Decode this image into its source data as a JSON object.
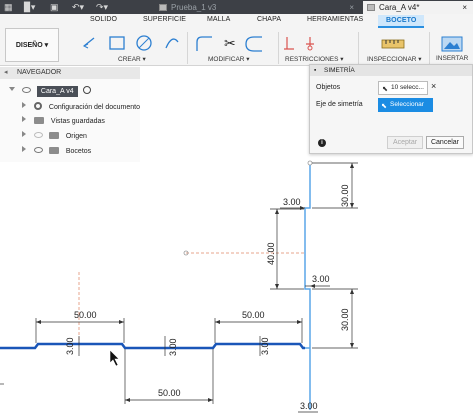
{
  "titlebar": {
    "tab1": "Prueba_1 v3",
    "tab2": "Cara_A v4*",
    "close": "×"
  },
  "ribbon": {
    "tabs": [
      "SOLIDO",
      "SUPERFICIE",
      "MALLA",
      "CHAPA",
      "HERRAMIENTAS",
      "BOCETO"
    ],
    "design_label": "DISEÑO ▾",
    "groups": [
      "CREAR ▾",
      "MODIFICAR ▾",
      "RESTRICCIONES ▾",
      "INSPECCIONAR ▾",
      "INSERTAR ▾"
    ]
  },
  "navigator": {
    "title": "NAVEGADOR",
    "root": "Cara_A v4",
    "items": [
      "Configuración del documento",
      "Vistas guardadas",
      "Origen",
      "Bocetos"
    ]
  },
  "symmetry": {
    "title": "SIMETRÍA",
    "objects_label": "Objetos",
    "objects_value": "10 selecc...",
    "axis_label": "Eje de simetría",
    "axis_value": "Seleccionar",
    "ok": "Aceptar",
    "cancel": "Cancelar"
  },
  "dimensions": {
    "d50_top_left": "50.00",
    "d50_top_right": "50.00",
    "d50_bottom": "50.00",
    "d3_a": "3.00",
    "d3_b": "3.00",
    "d3_c": "3.00",
    "d3_d": "3.00",
    "d3_e": "3.00",
    "d3_f": "3.00",
    "d30_top": "30.00",
    "d40": "40.00",
    "d30_right": "30.00"
  },
  "colors": {
    "sketch_line": "#2f7fd6",
    "selected_line": "#1a56b8",
    "accent": "#1b8ce3"
  }
}
